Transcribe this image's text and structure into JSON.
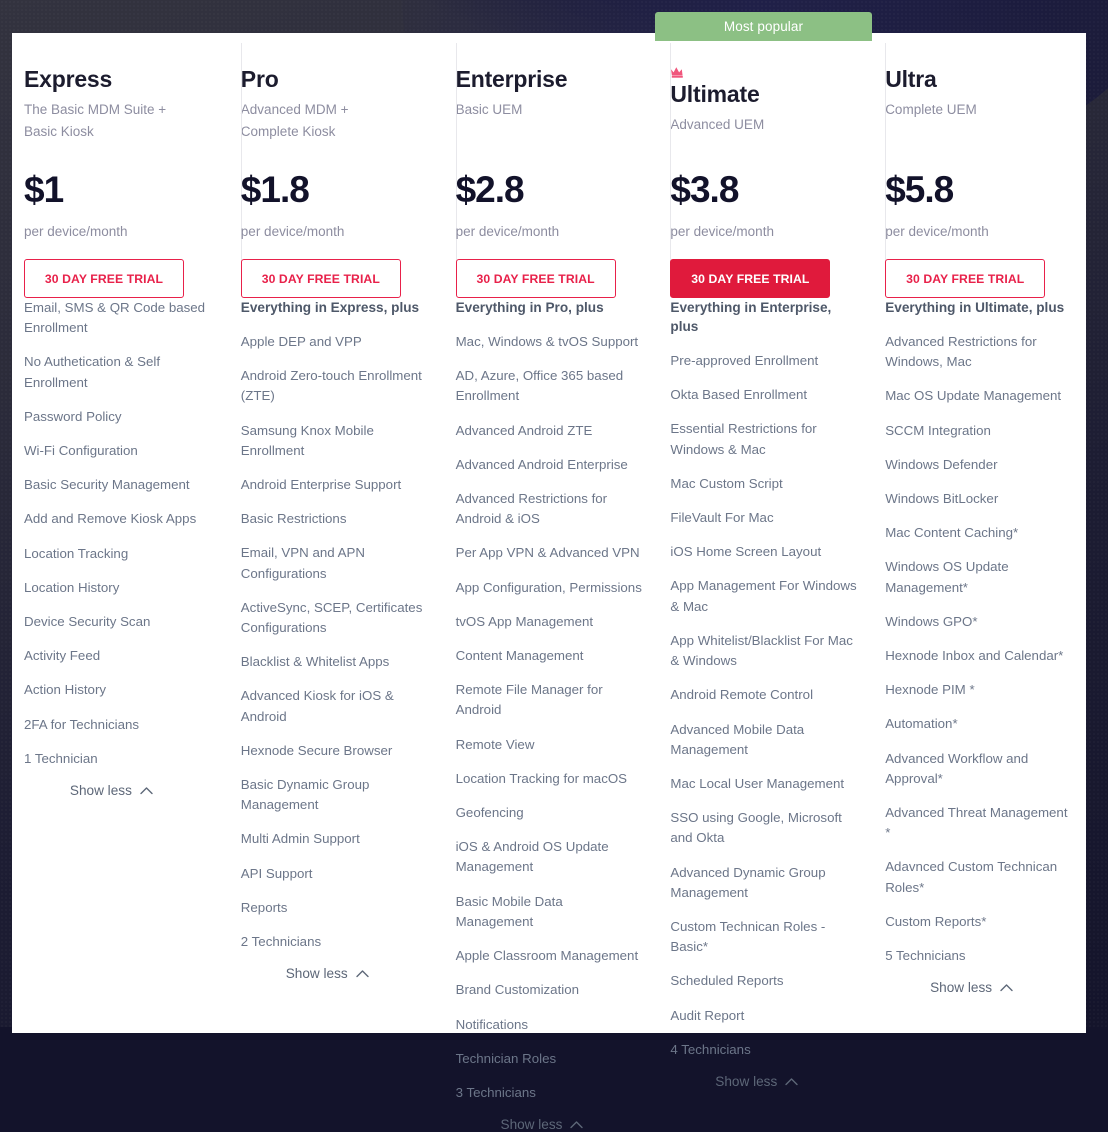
{
  "badge": {
    "label": "Most popular"
  },
  "show_less_label": "Show less",
  "colors": {
    "accent_red": "#e8214a",
    "filled_red": "#e01a3c",
    "badge_green": "#8cc084",
    "crown_pink": "#f0567c",
    "backdrop_dark": "#1d1d33"
  },
  "plans": [
    {
      "name": "Express",
      "subtitle": "The Basic MDM Suite + Basic Kiosk",
      "price": "$1",
      "price_unit": "per device/month",
      "cta": "30 DAY FREE TRIAL",
      "cta_style": "outline",
      "popular": false,
      "features_heading": "",
      "features": [
        "Email, SMS & QR Code based Enrollment",
        "No Authetication & Self Enrollment",
        "Password Policy",
        "Wi-Fi Configuration",
        "Basic Security Management",
        "Add and Remove Kiosk Apps",
        "Location Tracking",
        "Location History",
        "Device Security Scan",
        "Activity Feed",
        "Action History",
        "2FA for Technicians",
        "1 Technician"
      ]
    },
    {
      "name": "Pro",
      "subtitle": "Advanced MDM + Complete Kiosk",
      "price": "$1.8",
      "price_unit": "per device/month",
      "cta": "30 DAY FREE TRIAL",
      "cta_style": "outline",
      "popular": false,
      "features_heading": "Everything in Express, plus",
      "features": [
        "Apple DEP and VPP",
        "Android Zero-touch Enrollment (ZTE)",
        "Samsung Knox Mobile Enrollment",
        "Android Enterprise Support",
        "Basic Restrictions",
        "Email, VPN and APN Configurations",
        "ActiveSync, SCEP, Certificates Configurations",
        "Blacklist & Whitelist Apps",
        "Advanced Kiosk for iOS & Android",
        "Hexnode Secure Browser",
        "Basic Dynamic Group Management",
        "Multi Admin Support",
        "API Support",
        "Reports",
        "2 Technicians"
      ]
    },
    {
      "name": "Enterprise",
      "subtitle": "Basic UEM",
      "price": "$2.8",
      "price_unit": "per device/month",
      "cta": "30 DAY FREE TRIAL",
      "cta_style": "outline",
      "popular": false,
      "features_heading": "Everything in Pro, plus",
      "features": [
        "Mac, Windows & tvOS Support",
        "AD, Azure, Office 365 based Enrollment",
        "Advanced Android ZTE",
        "Advanced Android Enterprise",
        "Advanced Restrictions for Android & iOS",
        "Per App VPN & Advanced VPN",
        "App Configuration, Permissions",
        "tvOS App Management",
        "Content Management",
        "Remote File Manager for Android",
        "Remote View",
        "Location Tracking for macOS",
        "Geofencing",
        "iOS & Android OS Update Management",
        "Basic Mobile Data Management",
        "Apple Classroom Management",
        "Brand Customization",
        "Notifications",
        "Technician Roles",
        "3 Technicians"
      ]
    },
    {
      "name": "Ultimate",
      "subtitle": "Advanced UEM",
      "price": "$3.8",
      "price_unit": "per device/month",
      "cta": "30 DAY FREE TRIAL",
      "cta_style": "filled",
      "popular": true,
      "features_heading": "Everything in Enterprise, plus",
      "features": [
        "Pre-approved Enrollment",
        "Okta Based Enrollment",
        "Essential Restrictions for Windows & Mac",
        "Mac Custom Script",
        "FileVault For Mac",
        "iOS Home Screen Layout",
        "App Management For Windows & Mac",
        "App Whitelist/Blacklist For Mac & Windows",
        "Android Remote Control",
        "Advanced Mobile Data Management",
        "Mac Local User Management",
        "SSO using Google, Microsoft and Okta",
        "Advanced Dynamic Group Management",
        "Custom Technican Roles - Basic*",
        "Scheduled Reports",
        "Audit Report",
        "4 Technicians"
      ]
    },
    {
      "name": "Ultra",
      "subtitle": "Complete UEM",
      "price": "$5.8",
      "price_unit": "per device/month",
      "cta": "30 DAY FREE TRIAL",
      "cta_style": "outline",
      "popular": false,
      "features_heading": "Everything in Ultimate, plus",
      "features": [
        "Advanced Restrictions for Windows, Mac",
        "Mac OS Update Management",
        "SCCM Integration",
        "Windows Defender",
        "Windows BitLocker",
        "Mac Content Caching*",
        "Windows OS Update Management*",
        "Windows GPO*",
        "Hexnode Inbox and Calendar*",
        "Hexnode PIM *",
        "Automation*",
        "Advanced Workflow and Approval*",
        "Advanced Threat Management *",
        "Adavnced Custom Technican Roles*",
        "Custom Reports*",
        "5 Technicians"
      ]
    }
  ]
}
